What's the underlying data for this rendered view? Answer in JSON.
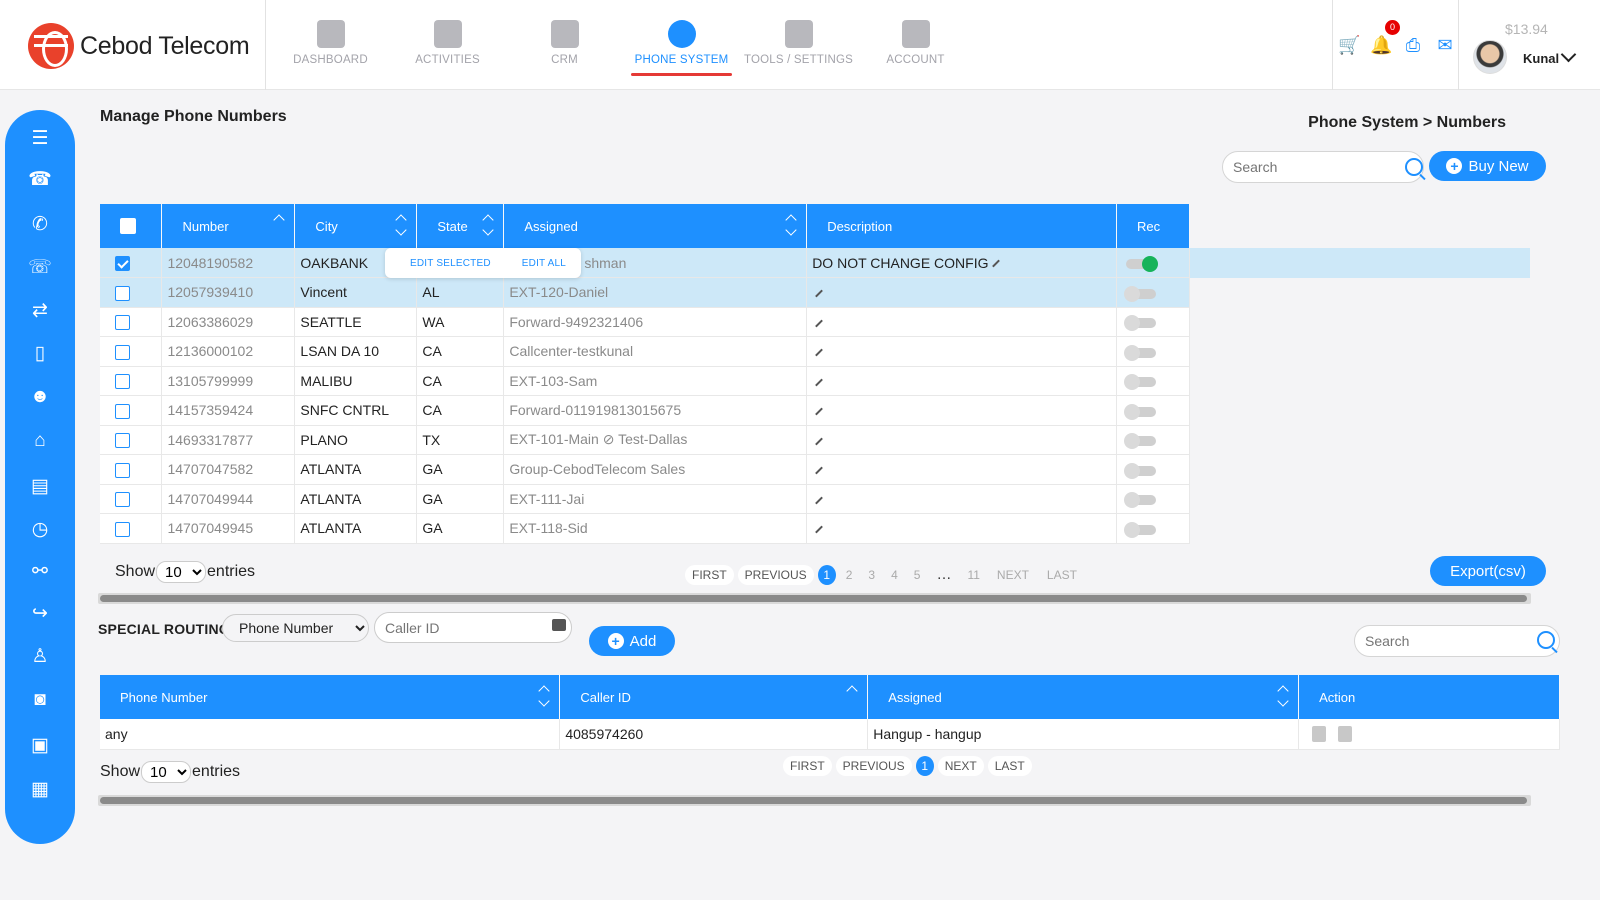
{
  "brand": {
    "name": "Cebod Telecom"
  },
  "nav": [
    {
      "label": "DASHBOARD",
      "icon": "dashboard-icon"
    },
    {
      "label": "ACTIVITIES",
      "icon": "activities-icon"
    },
    {
      "label": "CRM",
      "icon": "crm-icon"
    },
    {
      "label": "PHONE SYSTEM",
      "icon": "phone-system-icon",
      "active": true
    },
    {
      "label": "TOOLS / SETTINGS",
      "icon": "tools-icon"
    },
    {
      "label": "ACCOUNT",
      "icon": "account-icon"
    }
  ],
  "header": {
    "balance": "$13.94",
    "user": "Kunal",
    "notification_count": "0",
    "icons": [
      "cart-icon",
      "bell-icon",
      "printer-icon",
      "mail-icon"
    ]
  },
  "sidebar": [
    "menu-icon",
    "phone-keypad-icon",
    "call-icon",
    "fax-icon",
    "user-transfer-icon",
    "devices-icon",
    "users-group-icon",
    "conference-icon",
    "document-icon",
    "timer-icon",
    "link-icon",
    "call-forward-icon",
    "agent-icon",
    "bot-icon",
    "voicemail-icon",
    "contact-card-icon"
  ],
  "page": {
    "title": "Manage Phone Numbers",
    "breadcrumb": "Phone System > Numbers",
    "search_placeholder": "Search",
    "buy_new": "Buy New",
    "export": "Export(csv)"
  },
  "numbers_table": {
    "headers": [
      "Number",
      "City",
      "State",
      "Assigned",
      "Description",
      "Rec"
    ],
    "rows": [
      {
        "number": "12048190582",
        "city": "OAKBANK",
        "state": "",
        "assigned": "shman",
        "description": "DO NOT CHANGE CONFIG",
        "rec": true,
        "checked": true
      },
      {
        "number": "12057939410",
        "city": "Vincent",
        "state": "AL",
        "assigned": "EXT-120-Daniel",
        "description": "",
        "rec": false,
        "checked": false
      },
      {
        "number": "12063386029",
        "city": "SEATTLE",
        "state": "WA",
        "assigned": "Forward-9492321406",
        "description": "",
        "rec": false,
        "checked": false
      },
      {
        "number": "12136000102",
        "city": "LSAN DA 10",
        "state": "CA",
        "assigned": "Callcenter-testkunal",
        "description": "",
        "rec": false,
        "checked": false
      },
      {
        "number": "13105799999",
        "city": "MALIBU",
        "state": "CA",
        "assigned": "EXT-103-Sam",
        "description": "",
        "rec": false,
        "checked": false
      },
      {
        "number": "14157359424",
        "city": "SNFC CNTRL",
        "state": "CA",
        "assigned": "Forward-011919813015675",
        "description": "",
        "rec": false,
        "checked": false
      },
      {
        "number": "14693317877",
        "city": "PLANO",
        "state": "TX",
        "assigned": "EXT-101-Main ⊘ Test-Dallas",
        "description": "",
        "rec": false,
        "checked": false
      },
      {
        "number": "14707047582",
        "city": "ATLANTA",
        "state": "GA",
        "assigned": "Group-CebodTelecom Sales",
        "description": "",
        "rec": false,
        "checked": false
      },
      {
        "number": "14707049944",
        "city": "ATLANTA",
        "state": "GA",
        "assigned": "EXT-111-Jai",
        "description": "",
        "rec": false,
        "checked": false
      },
      {
        "number": "14707049945",
        "city": "ATLANTA",
        "state": "GA",
        "assigned": "EXT-118-Sid",
        "description": "",
        "rec": false,
        "checked": false
      }
    ],
    "popup": {
      "edit_selected": "EDIT SELECTED",
      "edit_all": "EDIT ALL"
    }
  },
  "pagination1": {
    "show": "Show",
    "entries": "entries",
    "page_size": "10",
    "first": "FIRST",
    "previous": "PREVIOUS",
    "next": "NEXT",
    "last": "LAST",
    "pages": [
      "1",
      "2",
      "3",
      "4",
      "5",
      "…",
      "11"
    ],
    "current": "1"
  },
  "special_routing": {
    "label": "SPECIAL ROUTING",
    "type_select": "Phone Number",
    "callerid_placeholder": "Caller ID",
    "add": "Add",
    "search_placeholder": "Search",
    "headers": [
      "Phone Number",
      "Caller ID",
      "Assigned",
      "Action"
    ],
    "rows": [
      {
        "phone": "any",
        "caller_id": "4085974260",
        "assigned": "Hangup - hangup"
      }
    ]
  },
  "pagination2": {
    "show": "Show",
    "entries": "entries",
    "page_size": "10",
    "first": "FIRST",
    "previous": "PREVIOUS",
    "next": "NEXT",
    "last": "LAST",
    "current": "1"
  },
  "colors": {
    "accent": "#1e90ff",
    "selected_row": "#cde8f8",
    "rec_on": "#16b35a",
    "nav_underline": "#e53935"
  }
}
